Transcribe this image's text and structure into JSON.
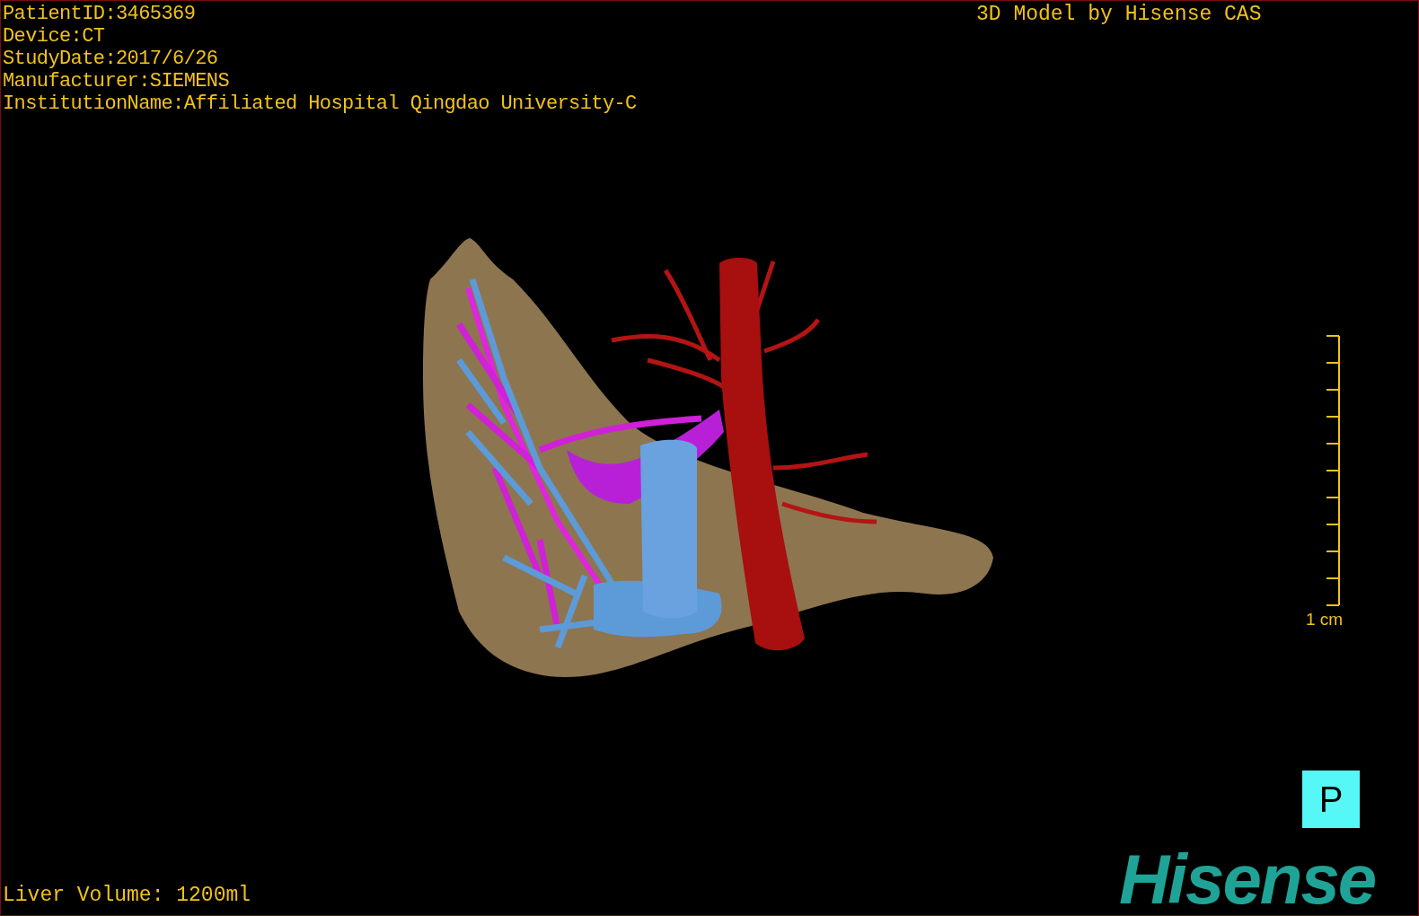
{
  "study_info": [
    "PatientID:3465369",
    "Device:CT",
    "StudyDate:2017/6/26",
    "Manufacturer:SIEMENS",
    "InstitutionName:Affiliated Hospital Qingdao University-C"
  ],
  "model_credit": "3D Model by Hisense CAS",
  "scale_bar": {
    "label": "1 cm"
  },
  "view_button": "P",
  "logo": "Hisense",
  "liver_volume": "Liver Volume: 1200ml"
}
